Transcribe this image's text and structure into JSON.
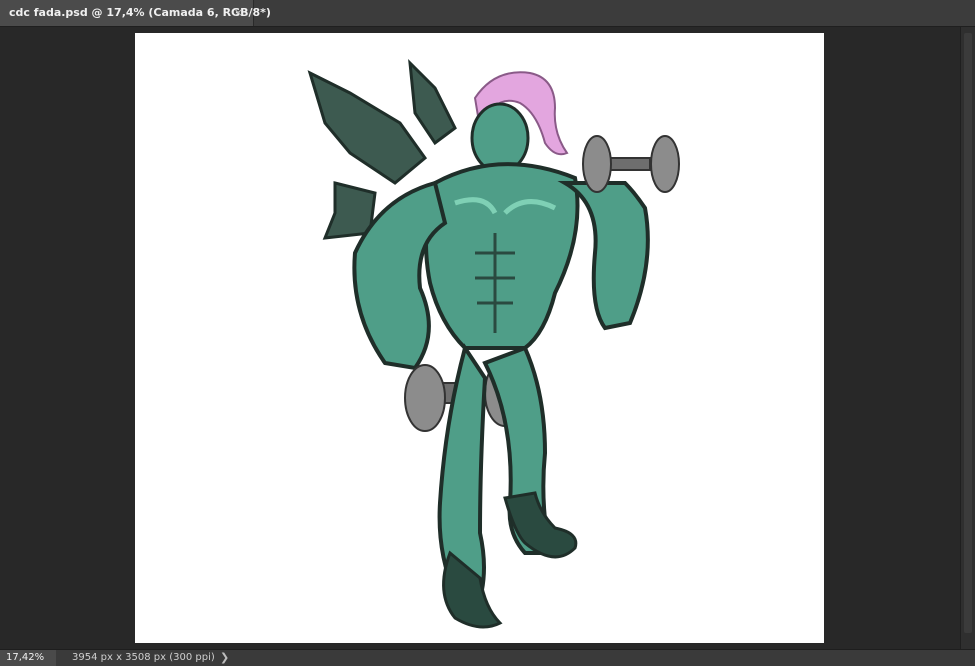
{
  "tab": {
    "title": "cdc fada.psd @ 17,4% (Camada 6, RGB/8*)",
    "close": "×"
  },
  "status": {
    "zoom": "17,42%",
    "doc_info": "3954 px x 3508 px (300 ppi)",
    "arrow": "❯"
  },
  "colors": {
    "skin": "#4f9e88",
    "skin_dark": "#2a4a40",
    "skin_light": "#7fd0b5",
    "hair": "#e3a6df",
    "wings": "#3d5a50",
    "dumbbell": "#8c8c8c"
  }
}
